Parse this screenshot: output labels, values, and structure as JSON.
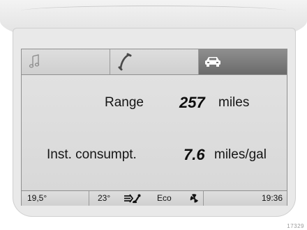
{
  "tabs": [
    {
      "icon": "music-note-icon",
      "active": false
    },
    {
      "icon": "phone-handset-icon",
      "active": false
    },
    {
      "icon": "car-icon",
      "active": true
    }
  ],
  "range": {
    "label": "Range",
    "value": "257",
    "unit": "miles"
  },
  "consumption": {
    "label": "Inst. consumpt.",
    "value": "7.6",
    "unit": "miles/gal"
  },
  "status_bar": {
    "outside_temp": "19,5°",
    "set_temp": "23°",
    "airflow_icon": "air-distribution-icon",
    "mode": "Eco",
    "fan_icon": "fan-icon",
    "clock": "19:36"
  },
  "figure_ref": "17329"
}
